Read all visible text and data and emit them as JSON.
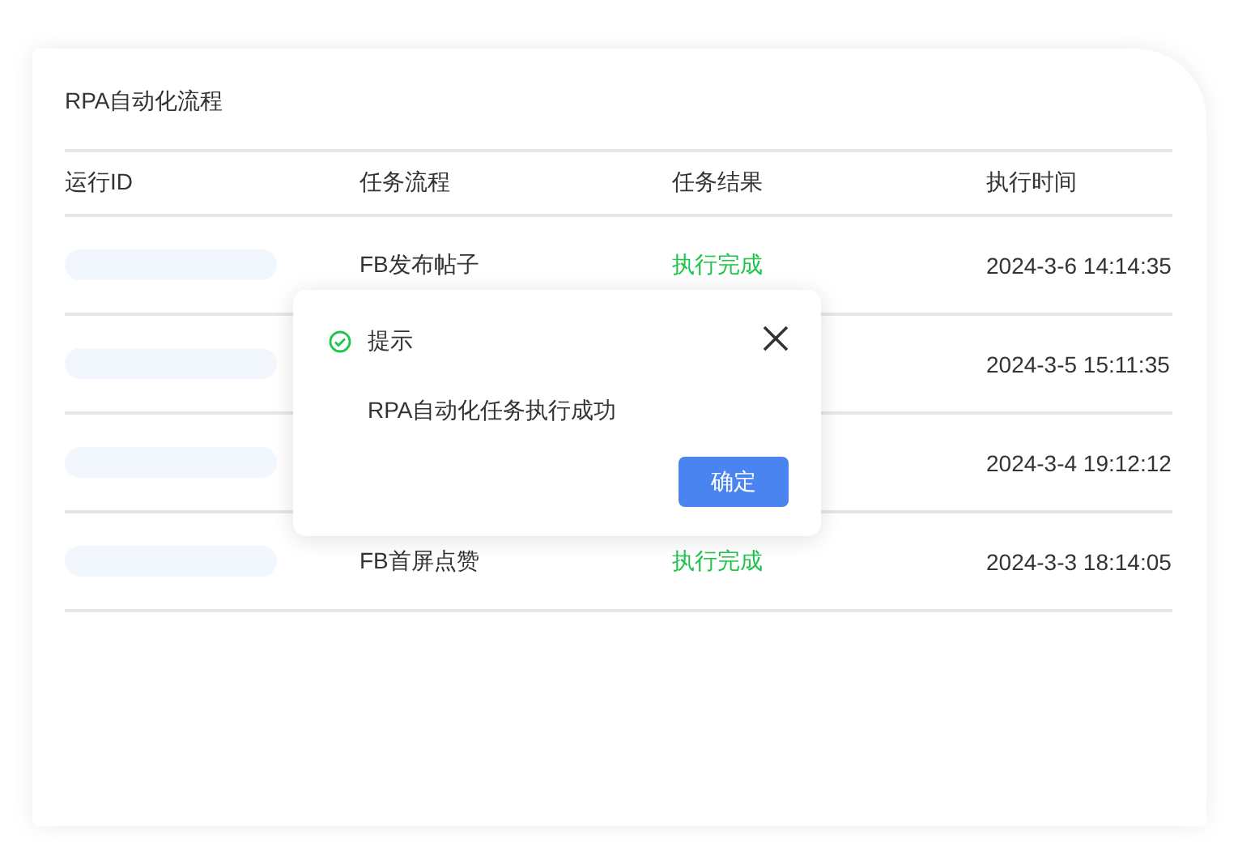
{
  "card": {
    "title": "RPA自动化流程"
  },
  "table": {
    "columns": [
      "运行ID",
      "任务流程",
      "任务结果",
      "执行时间"
    ],
    "rows": [
      {
        "flow": "FB发布帖子",
        "result": "执行完成",
        "time": "2024-3-6 14:14:35"
      },
      {
        "time": "2024-3-5 15:11:35"
      },
      {
        "time": "2024-3-4 19:12:12"
      },
      {
        "flow": "FB首屏点赞",
        "result": "执行完成",
        "time": "2024-3-3 18:14:05"
      }
    ]
  },
  "dialog": {
    "title": "提示",
    "message": "RPA自动化任务执行成功",
    "button": "确定"
  }
}
